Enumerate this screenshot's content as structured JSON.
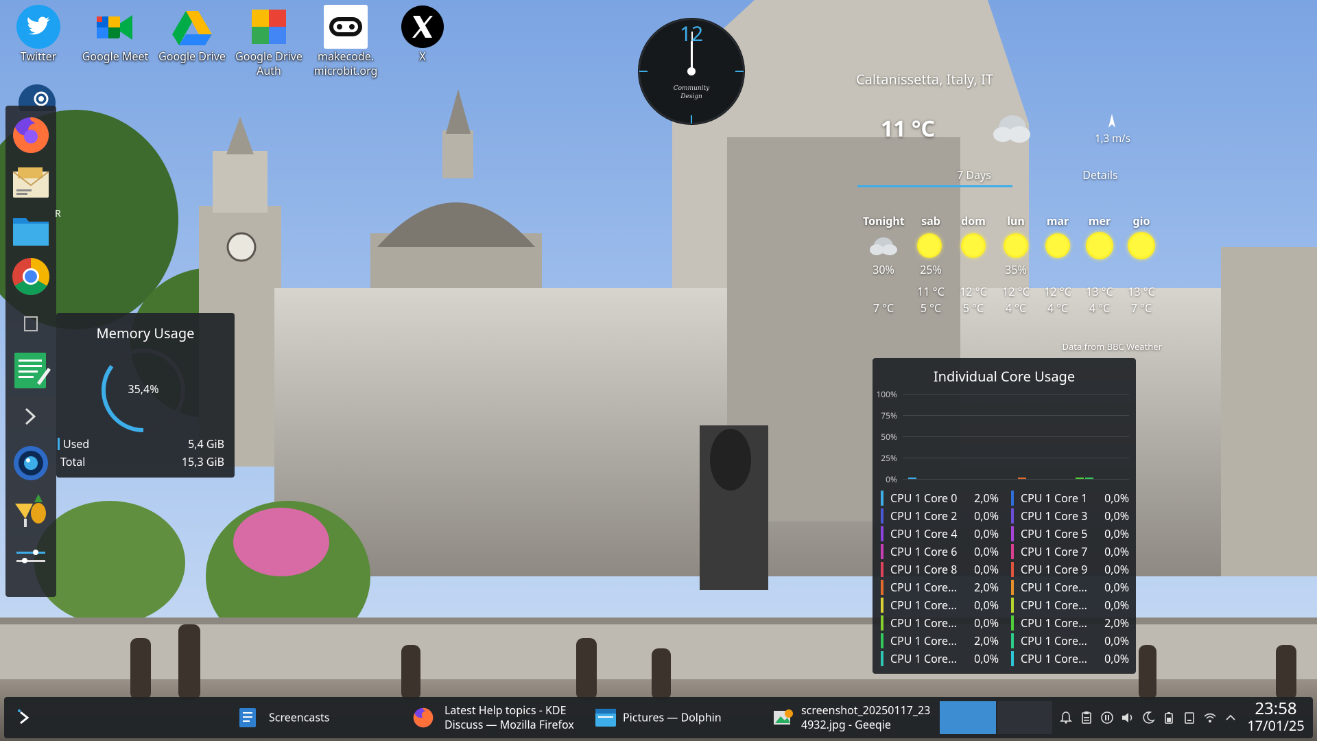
{
  "desktop_icons": [
    {
      "label": "Twitter",
      "icon": "twitter-bird-icon"
    },
    {
      "label": "Google Meet",
      "icon": "google-meet-icon"
    },
    {
      "label": "Google Drive",
      "icon": "google-drive-icon"
    },
    {
      "label": "Google Drive\nAuth",
      "icon": "google-drive-auth-icon"
    },
    {
      "label": "makecode.\nmicrobit.org",
      "icon": "microbit-icon"
    },
    {
      "label": "X",
      "icon": "x-logo-icon"
    }
  ],
  "dock": {
    "items": [
      "steam-icon",
      "firefox-icon",
      "mail-icon",
      "folder-icon",
      "chrome-icon",
      "note-icon",
      "text-editor-icon",
      "terminal-icon",
      "camera-icon",
      "tropical-drink-icon",
      "settings-sliders-icon"
    ],
    "partial_label": "R"
  },
  "clock_widget": {
    "numeral": "12",
    "brand_line1": "Community",
    "brand_line2": "Design",
    "hour": 12,
    "minute": 0
  },
  "weather": {
    "location": "Caltanissetta, Italy, IT",
    "temperature": "11 °C",
    "wind": "1,3 m/s",
    "tabs": [
      "7 Days",
      "Details"
    ],
    "active_tab": "7 Days",
    "source": "Data from BBC Weather",
    "forecast": [
      {
        "day": "Tonight",
        "icon": "cloud-night-icon",
        "precip": "30%",
        "high": "",
        "low": "7 °C"
      },
      {
        "day": "sab",
        "icon": "sun-cloud-icon",
        "precip": "25%",
        "high": "11 °C",
        "low": "5 °C"
      },
      {
        "day": "dom",
        "icon": "sun-cloud-icon",
        "precip": "",
        "high": "12 °C",
        "low": "5 °C"
      },
      {
        "day": "lun",
        "icon": "sun-cloud-icon",
        "precip": "35%",
        "high": "12 °C",
        "low": "4 °C"
      },
      {
        "day": "mar",
        "icon": "sun-cloud-icon",
        "precip": "",
        "high": "12 °C",
        "low": "4 °C"
      },
      {
        "day": "mer",
        "icon": "sun-icon",
        "precip": "",
        "high": "13 °C",
        "low": "4 °C"
      },
      {
        "day": "gio",
        "icon": "sun-icon",
        "precip": "",
        "high": "13 °C",
        "low": "7 °C"
      }
    ]
  },
  "memory": {
    "title": "Memory Usage",
    "percent_label": "35,4%",
    "fraction": 0.354,
    "used_label": "Used",
    "used_value": "5,4 GiB",
    "total_label": "Total",
    "total_value": "15,3 GiB",
    "accent": "#3daee9"
  },
  "cpu": {
    "title": "Individual Core Usage",
    "axis": [
      "100%",
      "75%",
      "50%",
      "25%",
      "0%"
    ],
    "cores": [
      {
        "name": "CPU 1 Core 0",
        "value": "2,0%",
        "color": "#3daee9"
      },
      {
        "name": "CPU 1 Core 1",
        "value": "0,0%",
        "color": "#2e6fd9"
      },
      {
        "name": "CPU 1 Core 2",
        "value": "0,0%",
        "color": "#4a57d6"
      },
      {
        "name": "CPU 1 Core 3",
        "value": "0,0%",
        "color": "#6b4fd6"
      },
      {
        "name": "CPU 1 Core 4",
        "value": "0,0%",
        "color": "#8e44e0"
      },
      {
        "name": "CPU 1 Core 5",
        "value": "0,0%",
        "color": "#a845d9"
      },
      {
        "name": "CPU 1 Core 6",
        "value": "0,0%",
        "color": "#c93fb8"
      },
      {
        "name": "CPU 1 Core 7",
        "value": "0,0%",
        "color": "#d94090"
      },
      {
        "name": "CPU 1 Core 8",
        "value": "0,0%",
        "color": "#e0445c"
      },
      {
        "name": "CPU 1 Core 9",
        "value": "0,0%",
        "color": "#e0553d"
      },
      {
        "name": "CPU 1 Core...",
        "value": "2,0%",
        "color": "#e26b2e"
      },
      {
        "name": "CPU 1 Core...",
        "value": "0,0%",
        "color": "#e6902a"
      },
      {
        "name": "CPU 1 Core...",
        "value": "0,0%",
        "color": "#dbd332"
      },
      {
        "name": "CPU 1 Core...",
        "value": "0,0%",
        "color": "#b6d62e"
      },
      {
        "name": "CPU 1 Core...",
        "value": "0,0%",
        "color": "#86d12e"
      },
      {
        "name": "CPU 1 Core...",
        "value": "2,0%",
        "color": "#4fcf3a"
      },
      {
        "name": "CPU 1 Core...",
        "value": "2,0%",
        "color": "#33c95a"
      },
      {
        "name": "CPU 1 Core...",
        "value": "0,0%",
        "color": "#2ecc8a"
      },
      {
        "name": "CPU 1 Core...",
        "value": "0,0%",
        "color": "#2fc7b4"
      },
      {
        "name": "CPU 1 Core...",
        "value": "0,0%",
        "color": "#2ec5d6"
      }
    ]
  },
  "taskbar": {
    "launcher_icon": "kde-launcher-icon",
    "tasks": [
      {
        "title": "Screencasts",
        "icon": "screencast-app-icon"
      },
      {
        "title": "Latest Help topics - KDE\nDiscuss — Mozilla Firefox",
        "icon": "firefox-icon"
      },
      {
        "title": "Pictures — Dolphin",
        "icon": "dolphin-folder-icon"
      },
      {
        "title": "screenshot_20250117_23\n4932.jpg - Geeqie",
        "icon": "geeqie-icon"
      }
    ],
    "tray_icons": [
      "notifications-icon",
      "clipboard-icon",
      "media-pause-icon",
      "volume-icon",
      "night-color-icon",
      "battery-icon",
      "device-icon",
      "wifi-icon",
      "expand-tray-icon"
    ],
    "time": "23:58",
    "date": "17/01/25"
  }
}
